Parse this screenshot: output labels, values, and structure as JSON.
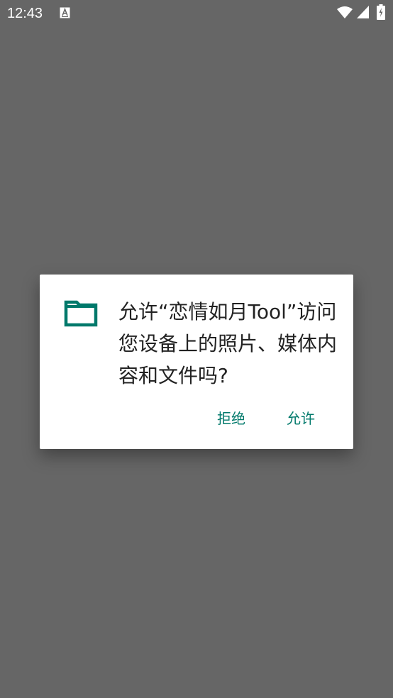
{
  "status_bar": {
    "time": "12:43",
    "notification_icon": "a-box-icon",
    "wifi_icon": "wifi-icon",
    "signal_icon": "cell-signal-icon",
    "battery_icon": "battery-charging-icon"
  },
  "dialog": {
    "icon": "folder-icon",
    "message": "允许“恋情如月Tool”访问您设备上的照片、媒体内容和文件吗?",
    "deny_label": "拒绝",
    "allow_label": "允许",
    "accent_color": "#00796b"
  },
  "colors": {
    "scrim": "#666666",
    "dialog_bg": "#ffffff"
  }
}
